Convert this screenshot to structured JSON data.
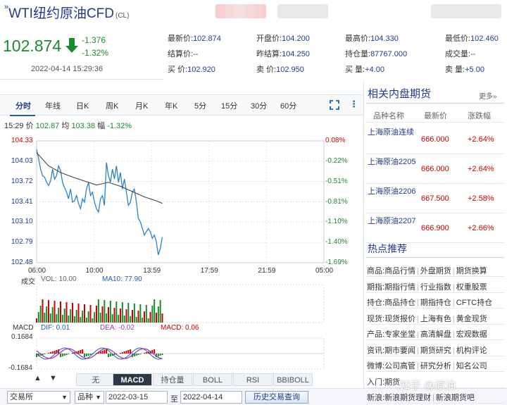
{
  "header": {
    "title": "WTI纽约原油CFD",
    "code": "(CL)",
    "price": "102.874",
    "change": "-1.376",
    "change_pct": "-1.32%",
    "datetime": "2022-04-14 15:29:36"
  },
  "quote": [
    [
      {
        "label": "最新价:",
        "value": "102.874"
      },
      {
        "label": "开盘价:",
        "value": "104.200"
      },
      {
        "label": "最高价:",
        "value": "104.330"
      },
      {
        "label": "最低价:",
        "value": "102.460"
      }
    ],
    [
      {
        "label": "结算价:",
        "value": "--"
      },
      {
        "label": "昨结算:",
        "value": "104.250"
      },
      {
        "label": "持仓量:",
        "value": "87767.000"
      },
      {
        "label": "成交量:",
        "value": "--"
      }
    ],
    [
      {
        "label": "买  价:",
        "value": "102.920"
      },
      {
        "label": "卖  价:",
        "value": "102.950"
      },
      {
        "label": "买  量:",
        "value": "+4.00"
      },
      {
        "label": "卖  量:",
        "value": "+5.00"
      }
    ]
  ],
  "tabs": [
    "分时",
    "年线",
    "日K",
    "周K",
    "月K",
    "年K",
    "5分",
    "15分",
    "30分",
    "60分"
  ],
  "active_tab": "分时",
  "info": {
    "time": "15:29",
    "price_label": "价",
    "price": "102.87",
    "avg_label": "均",
    "avg": "103.38",
    "amp_label": "幅",
    "amp": "-1.32%"
  },
  "chart_data": {
    "type": "line",
    "y_ticks": [
      "104.33",
      "104.03",
      "103.72",
      "103.41",
      "103.10",
      "102.79",
      "102.48"
    ],
    "y_pct_ticks": [
      "0.08%",
      "-0.22%",
      "-0.51%",
      "-0.81%",
      "-1.10%",
      "-1.40%",
      "-1.69%"
    ],
    "x_ticks": [
      "06:00",
      "10:00",
      "13:59",
      "17:59",
      "21:59",
      "05:00"
    ],
    "ylim": [
      102.48,
      104.33
    ],
    "xlim": [
      0,
      1440
    ],
    "series": [
      {
        "name": "价",
        "values": [
          [
            0,
            104.2
          ],
          [
            10,
            104.06
          ],
          [
            20,
            103.9
          ],
          [
            30,
            103.8
          ],
          [
            40,
            103.78
          ],
          [
            50,
            103.7
          ],
          [
            60,
            103.65
          ],
          [
            70,
            103.72
          ],
          [
            80,
            103.9
          ],
          [
            90,
            103.75
          ],
          [
            100,
            103.8
          ],
          [
            110,
            103.95
          ],
          [
            120,
            103.88
          ],
          [
            130,
            103.7
          ],
          [
            140,
            103.62
          ],
          [
            150,
            103.55
          ],
          [
            160,
            103.45
          ],
          [
            170,
            103.6
          ],
          [
            180,
            103.4
          ],
          [
            190,
            103.42
          ],
          [
            200,
            103.5
          ],
          [
            210,
            103.38
          ],
          [
            220,
            103.3
          ],
          [
            230,
            103.45
          ],
          [
            240,
            103.4
          ],
          [
            250,
            103.6
          ],
          [
            260,
            103.7
          ],
          [
            270,
            103.5
          ],
          [
            280,
            103.55
          ],
          [
            290,
            103.4
          ],
          [
            300,
            103.3
          ],
          [
            310,
            103.25
          ],
          [
            320,
            103.45
          ],
          [
            330,
            103.5
          ],
          [
            340,
            103.35
          ],
          [
            350,
            104.0
          ],
          [
            360,
            103.8
          ],
          [
            370,
            103.7
          ],
          [
            380,
            103.9
          ],
          [
            390,
            103.75
          ],
          [
            400,
            103.95
          ],
          [
            410,
            103.7
          ],
          [
            420,
            103.85
          ],
          [
            430,
            103.6
          ],
          [
            440,
            103.75
          ],
          [
            450,
            103.55
          ],
          [
            460,
            103.35
          ],
          [
            470,
            103.4
          ],
          [
            480,
            103.55
          ],
          [
            490,
            103.6
          ],
          [
            500,
            103.4
          ],
          [
            510,
            103.15
          ],
          [
            520,
            103.1
          ],
          [
            530,
            103.0
          ],
          [
            540,
            102.9
          ],
          [
            550,
            102.95
          ],
          [
            560,
            103.0
          ],
          [
            570,
            102.95
          ],
          [
            580,
            102.85
          ],
          [
            590,
            102.9
          ],
          [
            600,
            102.8
          ],
          [
            610,
            102.6
          ],
          [
            620,
            102.7
          ],
          [
            630,
            102.87
          ]
        ]
      },
      {
        "name": "均",
        "values": [
          [
            0,
            104.15
          ],
          [
            60,
            103.95
          ],
          [
            120,
            103.85
          ],
          [
            180,
            103.78
          ],
          [
            240,
            103.72
          ],
          [
            300,
            103.66
          ],
          [
            360,
            103.7
          ],
          [
            420,
            103.64
          ],
          [
            480,
            103.56
          ],
          [
            540,
            103.48
          ],
          [
            600,
            103.42
          ],
          [
            630,
            103.38
          ]
        ]
      }
    ],
    "volume": {
      "label": "成交",
      "vol_label": "VOL:",
      "vol": "10.00",
      "ma_label": "MA10:",
      "ma": "77.90"
    },
    "macd": {
      "label": "MACD",
      "dif_label": "DIF:",
      "dif": "0.01",
      "dea_label": "DEA:",
      "dea": "-0.02",
      "macd_label": "MACD:",
      "macd": "0.06",
      "top": "0.1684",
      "bottom": "-0.1684"
    }
  },
  "indicators": [
    "无",
    "MACD",
    "持仓量",
    "BOLL",
    "RSI",
    "BBIBOLL"
  ],
  "active_indicator": "MACD",
  "nav": {
    "up": "▲",
    "down": "▼"
  },
  "bottom": {
    "exchange": "交易所",
    "variety": "品种",
    "date_from": "2022-03-15",
    "date_sep": "至",
    "date_to": "2022-04-14",
    "query": "历史交易查询"
  },
  "right": {
    "title": "相关内盘期货",
    "more": "更多»",
    "headers": [
      "品种名称",
      "最新价",
      "涨跌幅"
    ],
    "rows": [
      {
        "name": "上海原油连续",
        "price": "666.000",
        "chg": "+2.64%"
      },
      {
        "name": "上海原油2205",
        "price": "666.000",
        "chg": "+2.64%"
      },
      {
        "name": "上海原油2206",
        "price": "667.500",
        "chg": "+2.58%"
      },
      {
        "name": "上海原油2207",
        "price": "666.900",
        "chg": "+2.66%"
      }
    ],
    "hot_title": "热点推荐",
    "hot": [
      {
        "k": "商品:",
        "items": [
          "商品行情",
          "外盘期货",
          "期货换算"
        ]
      },
      {
        "k": "期指:",
        "items": [
          "期指行情",
          "行业指数",
          "权重股票"
        ]
      },
      {
        "k": "持仓:",
        "items": [
          "商品持仓",
          "期指持仓",
          "CFTC持仓"
        ]
      },
      {
        "k": "现货:",
        "items": [
          "现货报价",
          "上海有色",
          "黄金现货"
        ]
      },
      {
        "k": "产品:",
        "items": [
          "专家坐堂",
          "高清解盘",
          "宏观数据"
        ]
      },
      {
        "k": "资讯:",
        "items": [
          "期市要闻",
          "期货研究",
          "机构评论"
        ]
      },
      {
        "k": "微博:",
        "items": [
          "公司高管",
          "研究分析",
          "知名公司"
        ]
      },
      {
        "k": "入门:",
        "items": [
          "期货",
          "",
          "",
          ""
        ]
      },
      {
        "k": "新浪:",
        "items": [
          "新浪期货理财",
          "新浪期货吧"
        ]
      }
    ],
    "watermark": "知乎 @原油"
  },
  "colors": {
    "down": "#1a8b2b",
    "up": "#cc0000",
    "line": "#2c83c4",
    "avg": "#444444",
    "link": "#1f3b8c"
  }
}
